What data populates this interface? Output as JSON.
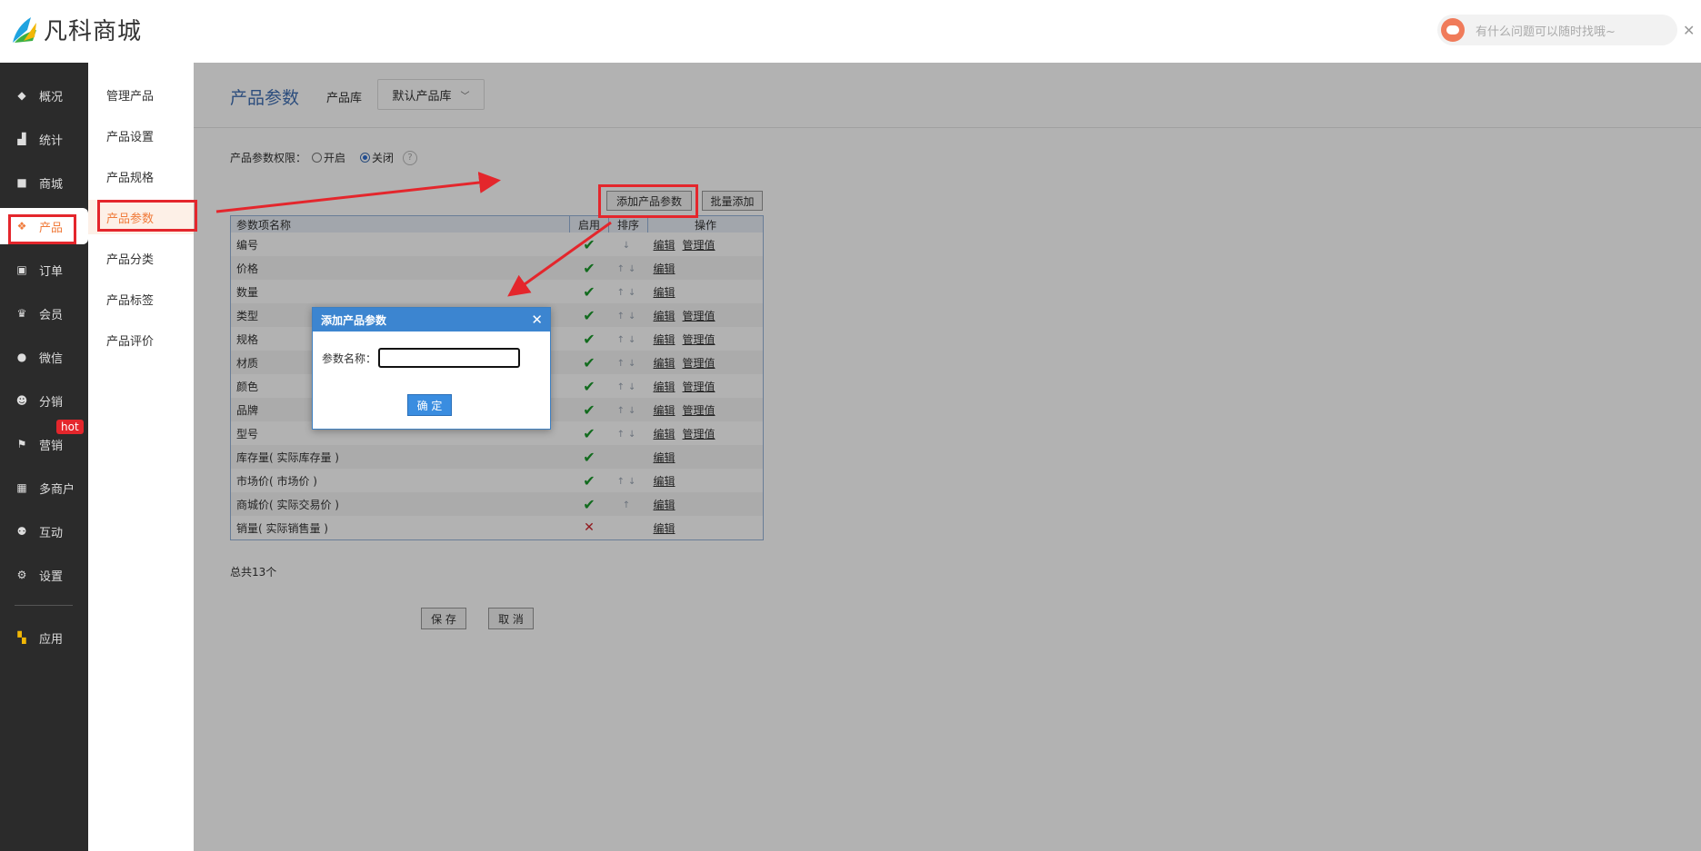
{
  "app": {
    "logo_text": "凡科商城"
  },
  "assistant": {
    "placeholder": "有什么问题可以随时找哦~",
    "close": "✕"
  },
  "sidebar": {
    "items": [
      {
        "label": "概况",
        "icon": "layers-icon"
      },
      {
        "label": "统计",
        "icon": "chart-icon"
      },
      {
        "label": "商城",
        "icon": "shop-icon"
      },
      {
        "label": "产品",
        "icon": "grid-icon"
      },
      {
        "label": "订单",
        "icon": "order-icon"
      },
      {
        "label": "会员",
        "icon": "crown-icon"
      },
      {
        "label": "微信",
        "icon": "wechat-icon"
      },
      {
        "label": "分销",
        "icon": "user-icon"
      },
      {
        "label": "营销",
        "icon": "flag-icon"
      },
      {
        "label": "多商户",
        "icon": "store-icon"
      },
      {
        "label": "互动",
        "icon": "people-icon"
      },
      {
        "label": "设置",
        "icon": "gear-icon"
      },
      {
        "label": "应用",
        "icon": "apps-icon"
      }
    ],
    "hot_badge": "hot",
    "active": "产品"
  },
  "subnav": {
    "items": [
      "管理产品",
      "产品设置",
      "产品规格",
      "产品参数",
      "产品分类",
      "产品标签",
      "产品评价"
    ],
    "active": "产品参数"
  },
  "page": {
    "title": "产品参数",
    "lib_label": "产品库",
    "lib_value": "默认产品库",
    "perm_label": "产品参数权限：",
    "perm_on": "开启",
    "perm_off": "关闭",
    "perm_selected": "关闭",
    "help": "?",
    "add_btn": "添加产品参数",
    "batch_btn": "批量添加",
    "total": "总共13个",
    "save_btn": "保 存",
    "cancel_btn": "取 消"
  },
  "table": {
    "headers": [
      "参数项名称",
      "启用",
      "排序",
      "操作"
    ],
    "rows": [
      {
        "name": "编号",
        "enabled": true,
        "sort": "↓",
        "ops": [
          "编辑",
          "管理值"
        ]
      },
      {
        "name": "价格",
        "enabled": true,
        "sort": "↑↓",
        "ops": [
          "编辑"
        ]
      },
      {
        "name": "数量",
        "enabled": true,
        "sort": "↑↓",
        "ops": [
          "编辑"
        ]
      },
      {
        "name": "类型",
        "enabled": true,
        "sort": "↑↓",
        "ops": [
          "编辑",
          "管理值"
        ]
      },
      {
        "name": "规格",
        "enabled": true,
        "sort": "↑↓",
        "ops": [
          "编辑",
          "管理值"
        ]
      },
      {
        "name": "材质",
        "enabled": true,
        "sort": "↑↓",
        "ops": [
          "编辑",
          "管理值"
        ]
      },
      {
        "name": "颜色",
        "enabled": true,
        "sort": "↑↓",
        "ops": [
          "编辑",
          "管理值"
        ]
      },
      {
        "name": "品牌",
        "enabled": true,
        "sort": "↑↓",
        "ops": [
          "编辑",
          "管理值"
        ]
      },
      {
        "name": "型号",
        "enabled": true,
        "sort": "↑↓",
        "ops": [
          "编辑",
          "管理值"
        ]
      },
      {
        "name": "库存量( 实际库存量 )",
        "enabled": true,
        "sort": "",
        "ops": [
          "编辑"
        ]
      },
      {
        "name": "市场价( 市场价 )",
        "enabled": true,
        "sort": "↑↓",
        "ops": [
          "编辑"
        ]
      },
      {
        "name": "商城价( 实际交易价 )",
        "enabled": true,
        "sort": "↑",
        "ops": [
          "编辑"
        ]
      },
      {
        "name": "销量( 实际销售量 )",
        "enabled": false,
        "sort": "",
        "ops": [
          "编辑"
        ]
      }
    ]
  },
  "dialog": {
    "title": "添加产品参数",
    "close": "✕",
    "field_label": "参数名称：",
    "field_value": "",
    "ok_btn": "确 定"
  },
  "colors": {
    "highlight_red": "#e4262c",
    "accent_orange": "#f07b3b",
    "title_blue": "#3f6fb3",
    "dialog_blue": "#3c85d0"
  }
}
